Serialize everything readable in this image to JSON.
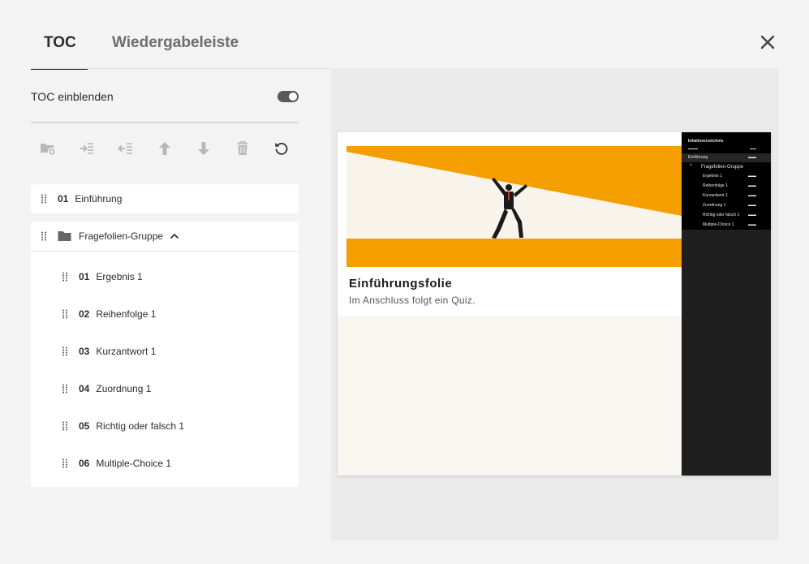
{
  "tabs": {
    "toc": "TOC",
    "playlist": "Wiedergabeleiste"
  },
  "toggle": {
    "label": "TOC einblenden",
    "on": true
  },
  "toolbar": {
    "icons": [
      "add-folder-icon",
      "indent-icon",
      "outdent-icon",
      "move-up-icon",
      "move-down-icon",
      "delete-icon",
      "reset-icon"
    ]
  },
  "toc": {
    "item1": {
      "num": "01",
      "label": "Einführung"
    },
    "group": {
      "label": "Fragefolien-Gruppe",
      "expanded": true
    },
    "children": [
      {
        "num": "01",
        "label": "Ergebnis 1"
      },
      {
        "num": "02",
        "label": "Reihenfolge 1"
      },
      {
        "num": "03",
        "label": "Kurzantwort 1"
      },
      {
        "num": "04",
        "label": "Zuordnung 1"
      },
      {
        "num": "05",
        "label": "Richtig oder falsch 1"
      },
      {
        "num": "06",
        "label": "Multiple-Choice 1"
      }
    ]
  },
  "preview": {
    "slide_title": "Einführungsfolie",
    "slide_subtitle": "Im Anschluss folgt ein Quiz.",
    "accent": "#f59e00",
    "mini_toc": {
      "header": "Inhaltsverzeichnis",
      "item1": "Einführung",
      "group": "Fragefolien-Gruppe",
      "children": [
        "Ergebnis 1",
        "Reihenfolge 1",
        "Kurzantwort 1",
        "Zuordnung 1",
        "Richtig oder falsch 1",
        "Multiple-Choice 1"
      ]
    }
  }
}
